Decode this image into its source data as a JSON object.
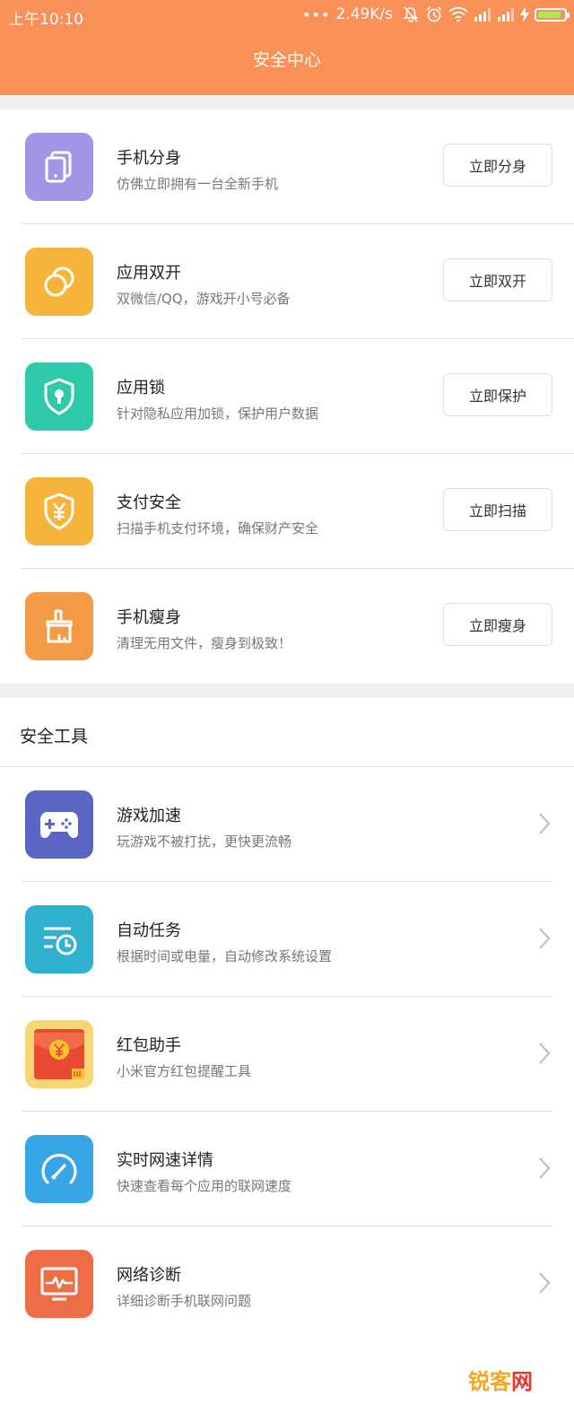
{
  "status_bar": {
    "time": "上午10:10",
    "dots": "•••",
    "network_speed": "2.49K/s",
    "icons": [
      "mute-icon",
      "alarm-icon",
      "wifi-icon",
      "signal-icon",
      "signal-icon",
      "charging-icon",
      "battery-icon"
    ],
    "battery_level": 0.9,
    "battery_color": "#a8ec54"
  },
  "header": {
    "title": "安全中心",
    "color": "#f89057"
  },
  "features": [
    {
      "icon": "phone-clone-icon",
      "color": "#a394e8",
      "title": "手机分身",
      "subtitle": "仿佛立即拥有一台全新手机",
      "button": "立即分身"
    },
    {
      "icon": "dual-app-icon",
      "color": "#f6b53a",
      "title": "应用双开",
      "subtitle": "双微信/QQ，游戏开小号必备",
      "button": "立即双开"
    },
    {
      "icon": "app-lock-icon",
      "color": "#2ec9a8",
      "title": "应用锁",
      "subtitle": "针对隐私应用加锁，保护用户数据",
      "button": "立即保护"
    },
    {
      "icon": "payment-shield-icon",
      "color": "#f6b53a",
      "title": "支付安全",
      "subtitle": "扫描手机支付环境，确保财产安全",
      "button": "立即扫描"
    },
    {
      "icon": "broom-icon",
      "color": "#f49a45",
      "title": "手机瘦身",
      "subtitle": "清理无用文件，瘦身到极致！",
      "button": "立即瘦身"
    }
  ],
  "tools_section": {
    "title": "安全工具"
  },
  "tools": [
    {
      "icon": "gamepad-icon",
      "color": "#5a66c4",
      "title": "游戏加速",
      "subtitle": "玩游戏不被打扰，更快更流畅"
    },
    {
      "icon": "scheduled-task-icon",
      "color": "#2fb1cf",
      "title": "自动任务",
      "subtitle": "根据时间或电量，自动修改系统设置"
    },
    {
      "icon": "red-envelope-icon",
      "color": "#e84a34",
      "title": "红包助手",
      "subtitle": "小米官方红包提醒工具"
    },
    {
      "icon": "speedometer-icon",
      "color": "#36a6e6",
      "title": "实时网速详情",
      "subtitle": "快速查看每个应用的联网速度"
    },
    {
      "icon": "network-diagnosis-icon",
      "color": "#ed6d47",
      "title": "网络诊断",
      "subtitle": "详细诊断手机联网问题"
    }
  ],
  "watermark": {
    "part1": "锐客",
    "part2": "网"
  }
}
